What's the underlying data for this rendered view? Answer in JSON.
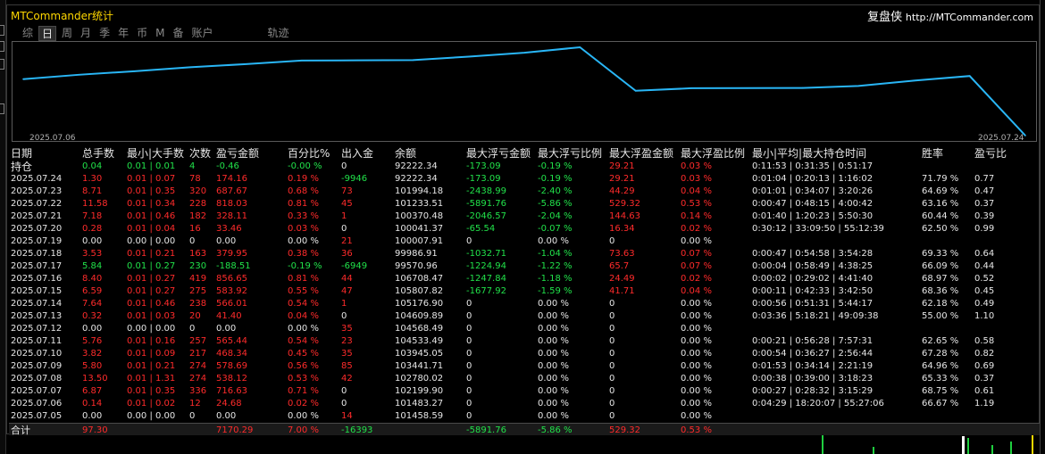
{
  "app": {
    "title": "MTCommander统计",
    "brand_cn": "复盘侠",
    "brand_url": "http://MTCommander.com"
  },
  "tabs": [
    {
      "label": "综",
      "active": false
    },
    {
      "label": "日",
      "active": true
    },
    {
      "label": "周",
      "active": false
    },
    {
      "label": "月",
      "active": false
    },
    {
      "label": "季",
      "active": false
    },
    {
      "label": "年",
      "active": false
    },
    {
      "label": "币",
      "active": false
    },
    {
      "label": "M",
      "active": false
    },
    {
      "label": "备",
      "active": false
    },
    {
      "label": "账户",
      "active": false
    },
    {
      "label": "轨迹",
      "active": false
    }
  ],
  "chart_data": {
    "type": "line",
    "x_start_label": "2025.07.06",
    "x_end_label": "2025.07.24",
    "series_color": "#29b6f6",
    "values": [
      101483.27,
      102199.9,
      102780.02,
      103441.71,
      103945.05,
      104533.49,
      104568.49,
      104609.89,
      105176.9,
      105807.82,
      106708.47,
      99570.96,
      99986.91,
      100007.91,
      100041.37,
      100370.48,
      101233.51,
      101994.18,
      92222.34
    ]
  },
  "table": {
    "headers": [
      "日期",
      "总手数",
      "最小|大手数",
      "次数",
      "盈亏金额",
      "百分比%",
      "出入金",
      "余额",
      "最大浮亏金额",
      "最大浮亏比例",
      "最大浮盈金额",
      "最大浮盈比例",
      "最小|平均|最大持仓时间",
      "胜率",
      "盈亏比"
    ],
    "holding": {
      "date": "持仓",
      "lots": "0.04",
      "minmax": "0.01 | 0.01",
      "count": "4",
      "pnl": "-0.46",
      "pct": "-0.00 %",
      "flow": "0",
      "balance": "92222.34",
      "max_dd": "-173.09",
      "max_dd_pct": "-0.19 %",
      "max_fp": "29.21",
      "max_fp_pct": "0.03 %",
      "hold_time": "0:11:53 | 0:31:35 | 0:51:17",
      "winrate": "",
      "pl_ratio": ""
    },
    "rows": [
      {
        "date": "2025.07.24",
        "lots": "1.30",
        "minmax": "0.01 | 0.07",
        "count": "78",
        "pnl": "174.16",
        "pct": "0.19 %",
        "flow": "-9946",
        "balance": "92222.34",
        "max_dd": "-173.09",
        "max_dd_pct": "-0.19 %",
        "max_fp": "29.21",
        "max_fp_pct": "0.03 %",
        "hold_time": "0:01:04 | 0:20:13 | 1:16:02",
        "winrate": "71.79 %",
        "pl_ratio": "0.77"
      },
      {
        "date": "2025.07.23",
        "lots": "8.71",
        "minmax": "0.01 | 0.35",
        "count": "320",
        "pnl": "687.67",
        "pct": "0.68 %",
        "flow": "73",
        "balance": "101994.18",
        "max_dd": "-2438.99",
        "max_dd_pct": "-2.40 %",
        "max_fp": "44.29",
        "max_fp_pct": "0.04 %",
        "hold_time": "0:01:01 | 0:34:07 | 3:20:26",
        "winrate": "64.69 %",
        "pl_ratio": "0.47"
      },
      {
        "date": "2025.07.22",
        "lots": "11.58",
        "minmax": "0.01 | 0.34",
        "count": "228",
        "pnl": "818.03",
        "pct": "0.81 %",
        "flow": "45",
        "balance": "101233.51",
        "max_dd": "-5891.76",
        "max_dd_pct": "-5.86 %",
        "max_fp": "529.32",
        "max_fp_pct": "0.53 %",
        "hold_time": "0:00:47 | 0:48:15 | 4:00:42",
        "winrate": "63.16 %",
        "pl_ratio": "0.37"
      },
      {
        "date": "2025.07.21",
        "lots": "7.18",
        "minmax": "0.01 | 0.46",
        "count": "182",
        "pnl": "328.11",
        "pct": "0.33 %",
        "flow": "1",
        "balance": "100370.48",
        "max_dd": "-2046.57",
        "max_dd_pct": "-2.04 %",
        "max_fp": "144.63",
        "max_fp_pct": "0.14 %",
        "hold_time": "0:01:40 | 1:20:23 | 5:50:30",
        "winrate": "60.44 %",
        "pl_ratio": "0.39"
      },
      {
        "date": "2025.07.20",
        "lots": "0.28",
        "minmax": "0.01 | 0.04",
        "count": "16",
        "pnl": "33.46",
        "pct": "0.03 %",
        "flow": "0",
        "balance": "100041.37",
        "max_dd": "-65.54",
        "max_dd_pct": "-0.07 %",
        "max_fp": "16.34",
        "max_fp_pct": "0.02 %",
        "hold_time": "0:30:12 | 33:09:50 | 55:12:39",
        "winrate": "62.50 %",
        "pl_ratio": "0.99"
      },
      {
        "date": "2025.07.19",
        "lots": "0.00",
        "minmax": "0.00 | 0.00",
        "count": "0",
        "pnl": "0.00",
        "pct": "0.00 %",
        "flow": "21",
        "balance": "100007.91",
        "max_dd": "0",
        "max_dd_pct": "0.00 %",
        "max_fp": "0",
        "max_fp_pct": "0.00 %",
        "hold_time": "",
        "winrate": "",
        "pl_ratio": ""
      },
      {
        "date": "2025.07.18",
        "lots": "3.53",
        "minmax": "0.01 | 0.21",
        "count": "163",
        "pnl": "379.95",
        "pct": "0.38 %",
        "flow": "36",
        "balance": "99986.91",
        "max_dd": "-1032.71",
        "max_dd_pct": "-1.04 %",
        "max_fp": "73.63",
        "max_fp_pct": "0.07 %",
        "hold_time": "0:00:47 | 0:54:58 | 3:54:28",
        "winrate": "69.33 %",
        "pl_ratio": "0.64"
      },
      {
        "date": "2025.07.17",
        "lots": "5.84",
        "minmax": "0.01 | 0.27",
        "count": "230",
        "pnl": "-188.51",
        "pct": "-0.19 %",
        "flow": "-6949",
        "balance": "99570.96",
        "max_dd": "-1224.94",
        "max_dd_pct": "-1.22 %",
        "max_fp": "65.7",
        "max_fp_pct": "0.07 %",
        "hold_time": "0:00:04 | 0:58:49 | 4:38:25",
        "winrate": "66.09 %",
        "pl_ratio": "0.44"
      },
      {
        "date": "2025.07.16",
        "lots": "8.40",
        "minmax": "0.01 | 0.27",
        "count": "419",
        "pnl": "856.65",
        "pct": "0.81 %",
        "flow": "44",
        "balance": "106708.47",
        "max_dd": "-1247.84",
        "max_dd_pct": "-1.18 %",
        "max_fp": "24.49",
        "max_fp_pct": "0.02 %",
        "hold_time": "0:00:02 | 0:29:02 | 4:41:40",
        "winrate": "68.97 %",
        "pl_ratio": "0.52"
      },
      {
        "date": "2025.07.15",
        "lots": "6.59",
        "minmax": "0.01 | 0.27",
        "count": "275",
        "pnl": "583.92",
        "pct": "0.55 %",
        "flow": "47",
        "balance": "105807.82",
        "max_dd": "-1677.92",
        "max_dd_pct": "-1.59 %",
        "max_fp": "41.71",
        "max_fp_pct": "0.04 %",
        "hold_time": "0:00:11 | 0:42:33 | 3:42:50",
        "winrate": "68.36 %",
        "pl_ratio": "0.45"
      },
      {
        "date": "2025.07.14",
        "lots": "7.64",
        "minmax": "0.01 | 0.46",
        "count": "238",
        "pnl": "566.01",
        "pct": "0.54 %",
        "flow": "1",
        "balance": "105176.90",
        "max_dd": "0",
        "max_dd_pct": "0.00 %",
        "max_fp": "0",
        "max_fp_pct": "0.00 %",
        "hold_time": "0:00:56 | 0:51:31 | 5:44:17",
        "winrate": "62.18 %",
        "pl_ratio": "0.49"
      },
      {
        "date": "2025.07.13",
        "lots": "0.32",
        "minmax": "0.01 | 0.03",
        "count": "20",
        "pnl": "41.40",
        "pct": "0.04 %",
        "flow": "0",
        "balance": "104609.89",
        "max_dd": "0",
        "max_dd_pct": "0.00 %",
        "max_fp": "0",
        "max_fp_pct": "0.00 %",
        "hold_time": "0:03:36 | 5:18:21 | 49:09:38",
        "winrate": "55.00 %",
        "pl_ratio": "1.10"
      },
      {
        "date": "2025.07.12",
        "lots": "0.00",
        "minmax": "0.00 | 0.00",
        "count": "0",
        "pnl": "0.00",
        "pct": "0.00 %",
        "flow": "35",
        "balance": "104568.49",
        "max_dd": "0",
        "max_dd_pct": "0.00 %",
        "max_fp": "0",
        "max_fp_pct": "0.00 %",
        "hold_time": "",
        "winrate": "",
        "pl_ratio": ""
      },
      {
        "date": "2025.07.11",
        "lots": "5.76",
        "minmax": "0.01 | 0.16",
        "count": "257",
        "pnl": "565.44",
        "pct": "0.54 %",
        "flow": "23",
        "balance": "104533.49",
        "max_dd": "0",
        "max_dd_pct": "0.00 %",
        "max_fp": "0",
        "max_fp_pct": "0.00 %",
        "hold_time": "0:00:21 | 0:56:28 | 7:57:31",
        "winrate": "62.65 %",
        "pl_ratio": "0.58"
      },
      {
        "date": "2025.07.10",
        "lots": "3.82",
        "minmax": "0.01 | 0.09",
        "count": "217",
        "pnl": "468.34",
        "pct": "0.45 %",
        "flow": "35",
        "balance": "103945.05",
        "max_dd": "0",
        "max_dd_pct": "0.00 %",
        "max_fp": "0",
        "max_fp_pct": "0.00 %",
        "hold_time": "0:00:54 | 0:36:27 | 2:56:44",
        "winrate": "67.28 %",
        "pl_ratio": "0.82"
      },
      {
        "date": "2025.07.09",
        "lots": "5.80",
        "minmax": "0.01 | 0.21",
        "count": "274",
        "pnl": "578.69",
        "pct": "0.56 %",
        "flow": "85",
        "balance": "103441.71",
        "max_dd": "0",
        "max_dd_pct": "0.00 %",
        "max_fp": "0",
        "max_fp_pct": "0.00 %",
        "hold_time": "0:01:53 | 0:34:14 | 2:21:19",
        "winrate": "64.96 %",
        "pl_ratio": "0.69"
      },
      {
        "date": "2025.07.08",
        "lots": "13.50",
        "minmax": "0.01 | 1.31",
        "count": "274",
        "pnl": "538.12",
        "pct": "0.53 %",
        "flow": "42",
        "balance": "102780.02",
        "max_dd": "0",
        "max_dd_pct": "0.00 %",
        "max_fp": "0",
        "max_fp_pct": "0.00 %",
        "hold_time": "0:00:38 | 0:39:00 | 3:18:23",
        "winrate": "65.33 %",
        "pl_ratio": "0.37"
      },
      {
        "date": "2025.07.07",
        "lots": "6.87",
        "minmax": "0.01 | 0.35",
        "count": "336",
        "pnl": "716.63",
        "pct": "0.71 %",
        "flow": "0",
        "balance": "102199.90",
        "max_dd": "0",
        "max_dd_pct": "0.00 %",
        "max_fp": "0",
        "max_fp_pct": "0.00 %",
        "hold_time": "0:00:27 | 0:28:32 | 3:15:29",
        "winrate": "68.75 %",
        "pl_ratio": "0.61"
      },
      {
        "date": "2025.07.06",
        "lots": "0.14",
        "minmax": "0.01 | 0.02",
        "count": "12",
        "pnl": "24.68",
        "pct": "0.02 %",
        "flow": "0",
        "balance": "101483.27",
        "max_dd": "0",
        "max_dd_pct": "0.00 %",
        "max_fp": "0",
        "max_fp_pct": "0.00 %",
        "hold_time": "0:04:29 | 18:20:07 | 55:27:06",
        "winrate": "66.67 %",
        "pl_ratio": "1.19"
      },
      {
        "date": "2025.07.05",
        "lots": "0.00",
        "minmax": "0.00 | 0.00",
        "count": "0",
        "pnl": "0.00",
        "pct": "0.00 %",
        "flow": "14",
        "balance": "101458.59",
        "max_dd": "0",
        "max_dd_pct": "0.00 %",
        "max_fp": "0",
        "max_fp_pct": "0.00 %",
        "hold_time": "",
        "winrate": "",
        "pl_ratio": ""
      }
    ],
    "total": {
      "date": "合计",
      "lots": "97.30",
      "minmax": "",
      "count": "",
      "pnl": "7170.29",
      "pct": "7.00 %",
      "flow": "-16393",
      "balance": "",
      "max_dd": "-5891.76",
      "max_dd_pct": "-5.86 %",
      "max_fp": "529.32",
      "max_fp_pct": "0.53 %",
      "hold_time": "",
      "winrate": "",
      "pl_ratio": ""
    }
  },
  "colors": {
    "positive": "#ff2b2b",
    "negative": "#21e24a",
    "neutral": "#e6e6e6",
    "title": "#ffd800",
    "line": "#29b6f6"
  }
}
